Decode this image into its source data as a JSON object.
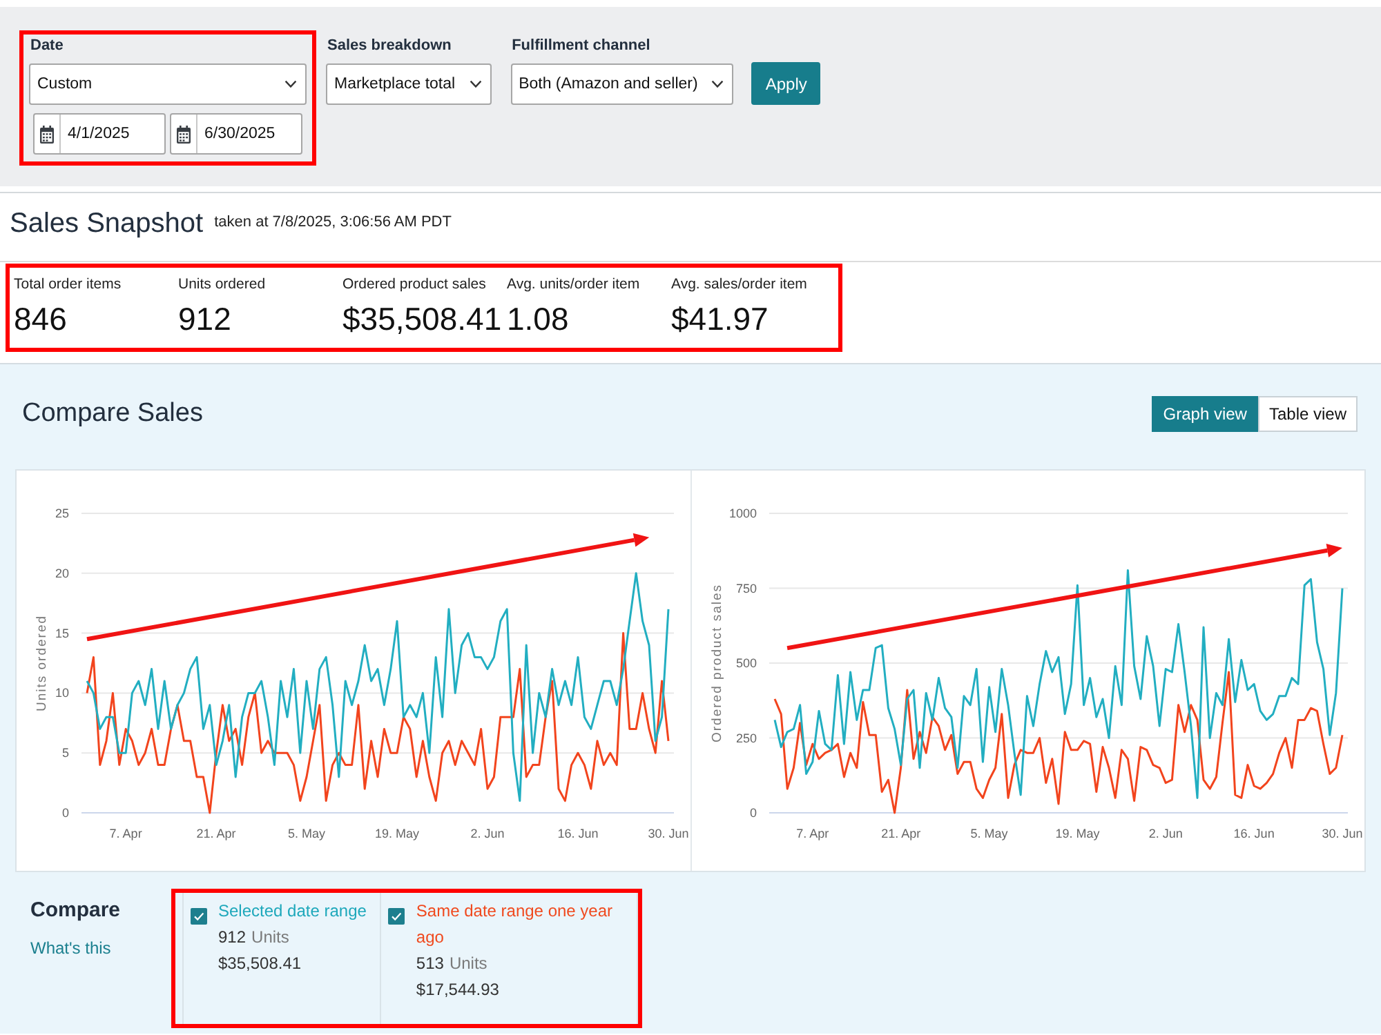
{
  "filters": [
    {
      "kind": "date",
      "label": "Date",
      "value": "Custom",
      "start_date": "4/1/2025",
      "end_date": "6/30/2025",
      "highlighted": true
    },
    {
      "kind": "select",
      "label": "Sales breakdown",
      "value": "Marketplace total",
      "highlighted": false
    },
    {
      "kind": "select",
      "label": "Fulfillment channel",
      "value": "Both (Amazon and seller)",
      "highlighted": false
    }
  ],
  "apply_button": "Apply",
  "snapshot": {
    "title": "Sales Snapshot",
    "taken_at": "taken at 7/8/2025, 3:06:56 AM PDT",
    "highlighted": true,
    "metrics": [
      {
        "label": "Total order items",
        "value": "846"
      },
      {
        "label": "Units ordered",
        "value": "912"
      },
      {
        "label": "Ordered product sales",
        "value": "$35,508.41"
      },
      {
        "label": "Avg. units/order item",
        "value": "1.08"
      },
      {
        "label": "Avg. sales/order item",
        "value": "$41.97"
      }
    ]
  },
  "compare_sales": {
    "title": "Compare Sales",
    "views": [
      {
        "label": "Graph view",
        "selected": true
      },
      {
        "label": "Table view",
        "selected": false
      }
    ],
    "charts": [
      {
        "trend_arrow": true,
        "chart_data": {
          "type": "line",
          "ylabel": "Units ordered",
          "grid": true,
          "categories": [
            null,
            null,
            null,
            null,
            null,
            null,
            "7. Apr",
            null,
            null,
            null,
            null,
            null,
            null,
            null,
            null,
            null,
            null,
            null,
            null,
            null,
            "21. Apr",
            null,
            null,
            null,
            null,
            null,
            null,
            null,
            null,
            null,
            null,
            null,
            null,
            null,
            "5. May",
            null,
            null,
            null,
            null,
            null,
            null,
            null,
            null,
            null,
            null,
            null,
            null,
            null,
            "19. May",
            null,
            null,
            null,
            null,
            null,
            null,
            null,
            null,
            null,
            null,
            null,
            null,
            null,
            "2. Jun",
            null,
            null,
            null,
            null,
            null,
            null,
            null,
            null,
            null,
            null,
            null,
            null,
            null,
            "16. Jun",
            null,
            null,
            null,
            null,
            null,
            null,
            null,
            null,
            null,
            null,
            null,
            null,
            null,
            "30. Jun"
          ],
          "ylim": [
            0,
            25
          ],
          "yticks": [
            0,
            5,
            10,
            15,
            20,
            25
          ],
          "series": [
            {
              "color": "#22aec1",
              "values": [
                11,
                10,
                7,
                8,
                8,
                5,
                5,
                10,
                11,
                9,
                12,
                7,
                11,
                7,
                9,
                10,
                12,
                13,
                7,
                9,
                4,
                6,
                9,
                3,
                8,
                10,
                10,
                11,
                8,
                4,
                11,
                8,
                12,
                5,
                11,
                7,
                12,
                13,
                9,
                3,
                11,
                9,
                11,
                14,
                11,
                12,
                9,
                12,
                16,
                8,
                9,
                8,
                10,
                5,
                13,
                8,
                17,
                10,
                14,
                15,
                13,
                13,
                12,
                13,
                16,
                17,
                5,
                1,
                14,
                5,
                10,
                8,
                12,
                9,
                11,
                9,
                13,
                8,
                7,
                9,
                11,
                11,
                9,
                12,
                16,
                20,
                16,
                14,
                6,
                8,
                17
              ]
            },
            {
              "color": "#f2441d",
              "values": [
                10,
                13,
                4,
                6,
                10,
                4,
                7,
                6,
                4,
                5,
                7,
                4,
                4,
                7,
                9,
                6,
                6,
                3,
                3,
                0,
                5,
                9,
                6,
                7,
                4,
                8,
                10,
                5,
                6,
                5,
                5,
                5,
                4,
                1,
                3,
                6,
                9,
                1,
                4,
                5,
                4,
                4,
                9,
                2,
                6,
                3,
                7,
                5,
                5,
                8,
                7,
                3,
                6,
                3,
                1,
                5,
                6,
                4,
                6,
                5,
                4,
                7,
                2,
                3,
                8,
                8,
                8,
                12,
                3,
                4,
                4,
                8,
                11,
                2,
                1,
                4,
                5,
                4,
                2,
                6,
                4,
                5,
                4,
                15,
                7,
                7,
                10,
                7,
                5,
                11,
                6
              ]
            }
          ]
        }
      },
      {
        "trend_arrow": true,
        "chart_data": {
          "type": "line",
          "ylabel": "Ordered product sales",
          "grid": true,
          "categories": [
            null,
            null,
            null,
            null,
            null,
            null,
            "7. Apr",
            null,
            null,
            null,
            null,
            null,
            null,
            null,
            null,
            null,
            null,
            null,
            null,
            null,
            "21. Apr",
            null,
            null,
            null,
            null,
            null,
            null,
            null,
            null,
            null,
            null,
            null,
            null,
            null,
            "5. May",
            null,
            null,
            null,
            null,
            null,
            null,
            null,
            null,
            null,
            null,
            null,
            null,
            null,
            "19. May",
            null,
            null,
            null,
            null,
            null,
            null,
            null,
            null,
            null,
            null,
            null,
            null,
            null,
            "2. Jun",
            null,
            null,
            null,
            null,
            null,
            null,
            null,
            null,
            null,
            null,
            null,
            null,
            null,
            "16. Jun",
            null,
            null,
            null,
            null,
            null,
            null,
            null,
            null,
            null,
            null,
            null,
            null,
            null,
            "30. Jun"
          ],
          "ylim": [
            0,
            1000
          ],
          "yticks": [
            0,
            250,
            500,
            750,
            1000
          ],
          "series": [
            {
              "color": "#22aec1",
              "values": [
                310,
                220,
                270,
                280,
                360,
                130,
                170,
                340,
                230,
                210,
                460,
                230,
                470,
                310,
                410,
                410,
                550,
                560,
                350,
                280,
                160,
                380,
                410,
                150,
                400,
                310,
                450,
                350,
                320,
                150,
                390,
                360,
                480,
                170,
                420,
                270,
                480,
                360,
                200,
                60,
                390,
                290,
                430,
                540,
                470,
                520,
                330,
                430,
                760,
                360,
                450,
                320,
                380,
                250,
                490,
                360,
                810,
                490,
                380,
                590,
                490,
                290,
                480,
                470,
                630,
                470,
                290,
                50,
                620,
                250,
                400,
                360,
                580,
                370,
                510,
                410,
                430,
                340,
                310,
                330,
                390,
                390,
                450,
                430,
                760,
                780,
                570,
                480,
                260,
                400,
                750
              ]
            },
            {
              "color": "#f2441d",
              "values": [
                380,
                330,
                80,
                150,
                300,
                160,
                230,
                180,
                200,
                210,
                230,
                120,
                200,
                150,
                370,
                260,
                260,
                70,
                110,
                0,
                150,
                410,
                180,
                270,
                200,
                320,
                290,
                210,
                260,
                130,
                170,
                170,
                80,
                50,
                110,
                150,
                330,
                50,
                160,
                210,
                200,
                200,
                250,
                100,
                180,
                30,
                270,
                210,
                210,
                240,
                230,
                70,
                220,
                150,
                50,
                210,
                180,
                40,
                220,
                210,
                160,
                150,
                100,
                110,
                360,
                270,
                360,
                310,
                110,
                80,
                120,
                300,
                470,
                60,
                50,
                160,
                90,
                80,
                100,
                130,
                200,
                250,
                150,
                310,
                310,
                350,
                340,
                230,
                130,
                150,
                260
              ]
            }
          ]
        }
      }
    ],
    "compare": {
      "title": "Compare",
      "link": "What's this",
      "highlighted": true,
      "ranges": [
        {
          "label": "Selected date range",
          "checked": true,
          "color": "#1ea8bb",
          "units": "912",
          "units_label": "Units",
          "sales": "$35,508.41"
        },
        {
          "label": "Same date range one year ago",
          "checked": true,
          "color": "#f04a1f",
          "units": "513",
          "units_label": "Units",
          "sales": "$17,544.93"
        }
      ]
    }
  }
}
